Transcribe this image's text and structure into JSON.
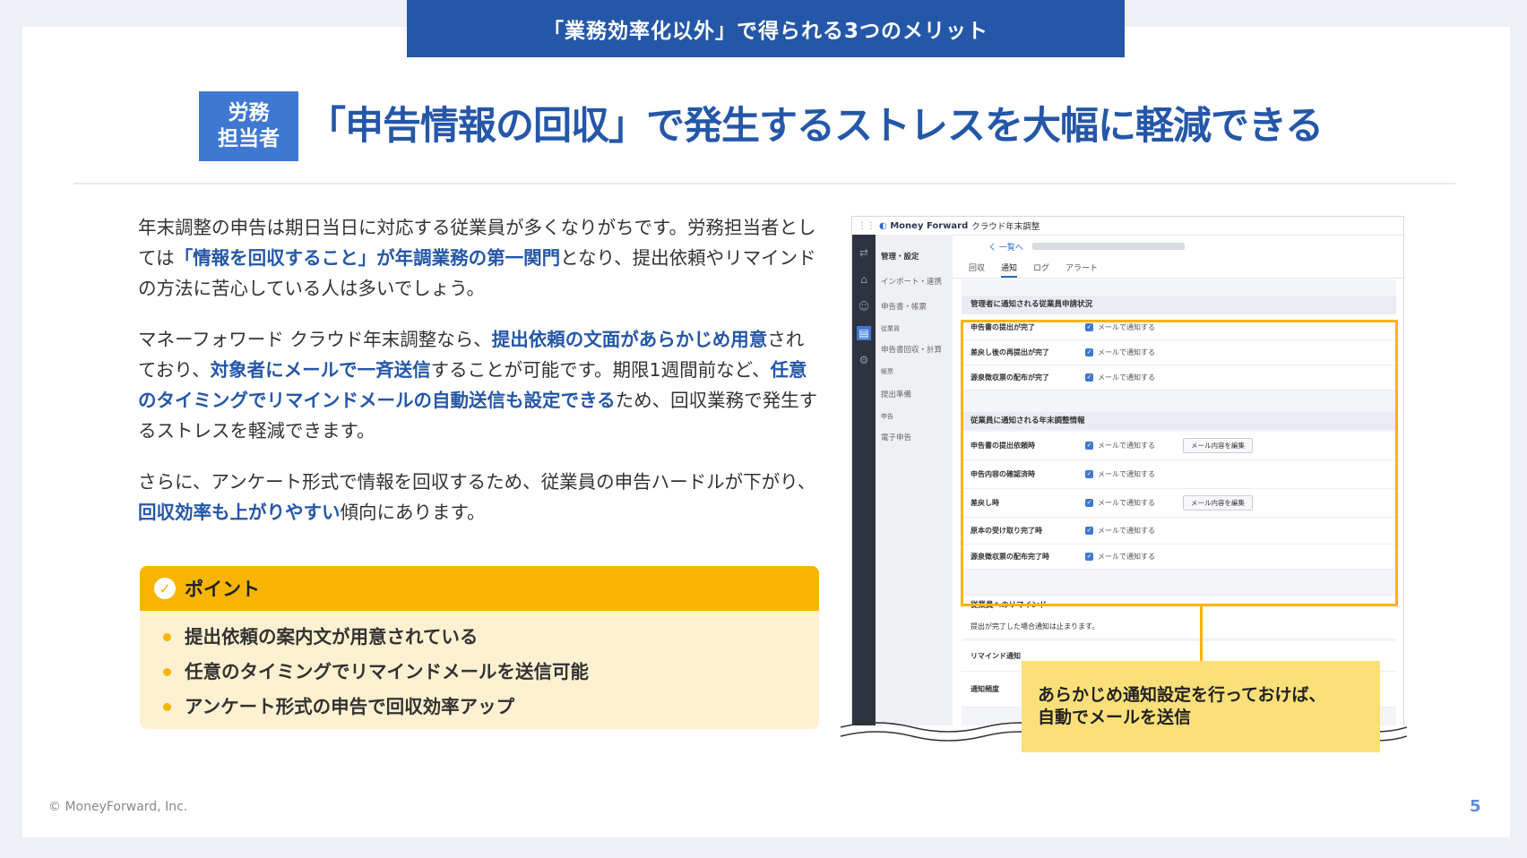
{
  "banner": "「業務効率化以外」で得られる3つのメリット",
  "badge": {
    "line1": "労務",
    "line2": "担当者"
  },
  "title": "「申告情報の回収」で発生するストレスを大幅に軽減できる",
  "paragraphs": [
    {
      "t1": "年末調整の申告は期日当日に対応する従業員が多くなりがちです。労務担当者としては",
      "h1": "「情報を回収すること」が年調業務の第一関門",
      "t2": "となり、提出依頼やリマインドの方法に苦心している人は多いでしょう。"
    },
    {
      "t1": "マネーフォワード クラウド年末調整なら、",
      "h1": "提出依頼の文面があらかじめ用意",
      "t2": "されており、",
      "h2": "対象者にメールで一斉送信",
      "t3": "することが可能です。期限1週間前など、",
      "h3": "任意のタイミングでリマインドメールの自動送信も設定できる",
      "t4": "ため、回収業務で発生するストレスを軽減できます。"
    },
    {
      "t1": "さらに、アンケート形式で情報を回収するため、従業員の申告ハードルが下がり、",
      "h1": "回収効率も上がりやすい",
      "t2": "傾向にあります。"
    }
  ],
  "point": {
    "heading": "ポイント",
    "icon": "check-circle-icon",
    "items": [
      "提出依頼の案内文が用意されている",
      "任意のタイミングでリマインドメールを送信可能",
      "アンケート形式の申告で回収効率アップ"
    ]
  },
  "screenshot": {
    "logo": "Money Forward",
    "app_name": "クラウド年末調整",
    "back_link": "く 一覧へ",
    "side_items": [
      "管理・設定",
      "インポート・連携",
      "申告書・帳票",
      "従業員",
      "申告書回収・計算",
      "帳票",
      "提出準備",
      "申告",
      "電子申告"
    ],
    "tabs": [
      "回収",
      "通知",
      "ログ",
      "アラート"
    ],
    "section1": "管理者に通知される従業員申請状況",
    "rows1": [
      "申告書の提出が完了",
      "差戻し後の再提出が完了",
      "源泉徴収票の配布が完了"
    ],
    "section2": "従業員に通知される年末調整情報",
    "rows2": [
      {
        "label": "申告書の提出依頼時",
        "button": "メール内容を編集"
      },
      {
        "label": "申告内容の確認済時",
        "button": ""
      },
      {
        "label": "差戻し時",
        "button": "メール内容を編集"
      },
      {
        "label": "原本の受け取り完了時",
        "button": ""
      },
      {
        "label": "源泉徴収票の配布完了時",
        "button": ""
      }
    ],
    "option_label": "メールで通知する",
    "section3": "従業員へのリマインド",
    "remind_note": "提出が完了した場合通知は止まります。",
    "remind_label": "リマインド通知",
    "freq_label": "通知頻度"
  },
  "callout": {
    "line1": "あらかじめ通知設定を行っておけば、",
    "line2": "自動でメールを送信"
  },
  "footer": {
    "copyright": "© MoneyForward, Inc.",
    "page": "5"
  },
  "colors": {
    "brand_blue": "#2557a8",
    "badge_blue": "#3f78d2",
    "accent_yellow": "#f7b500",
    "point_bg": "#fdf1d1",
    "callout_bg": "#fbe07a"
  }
}
